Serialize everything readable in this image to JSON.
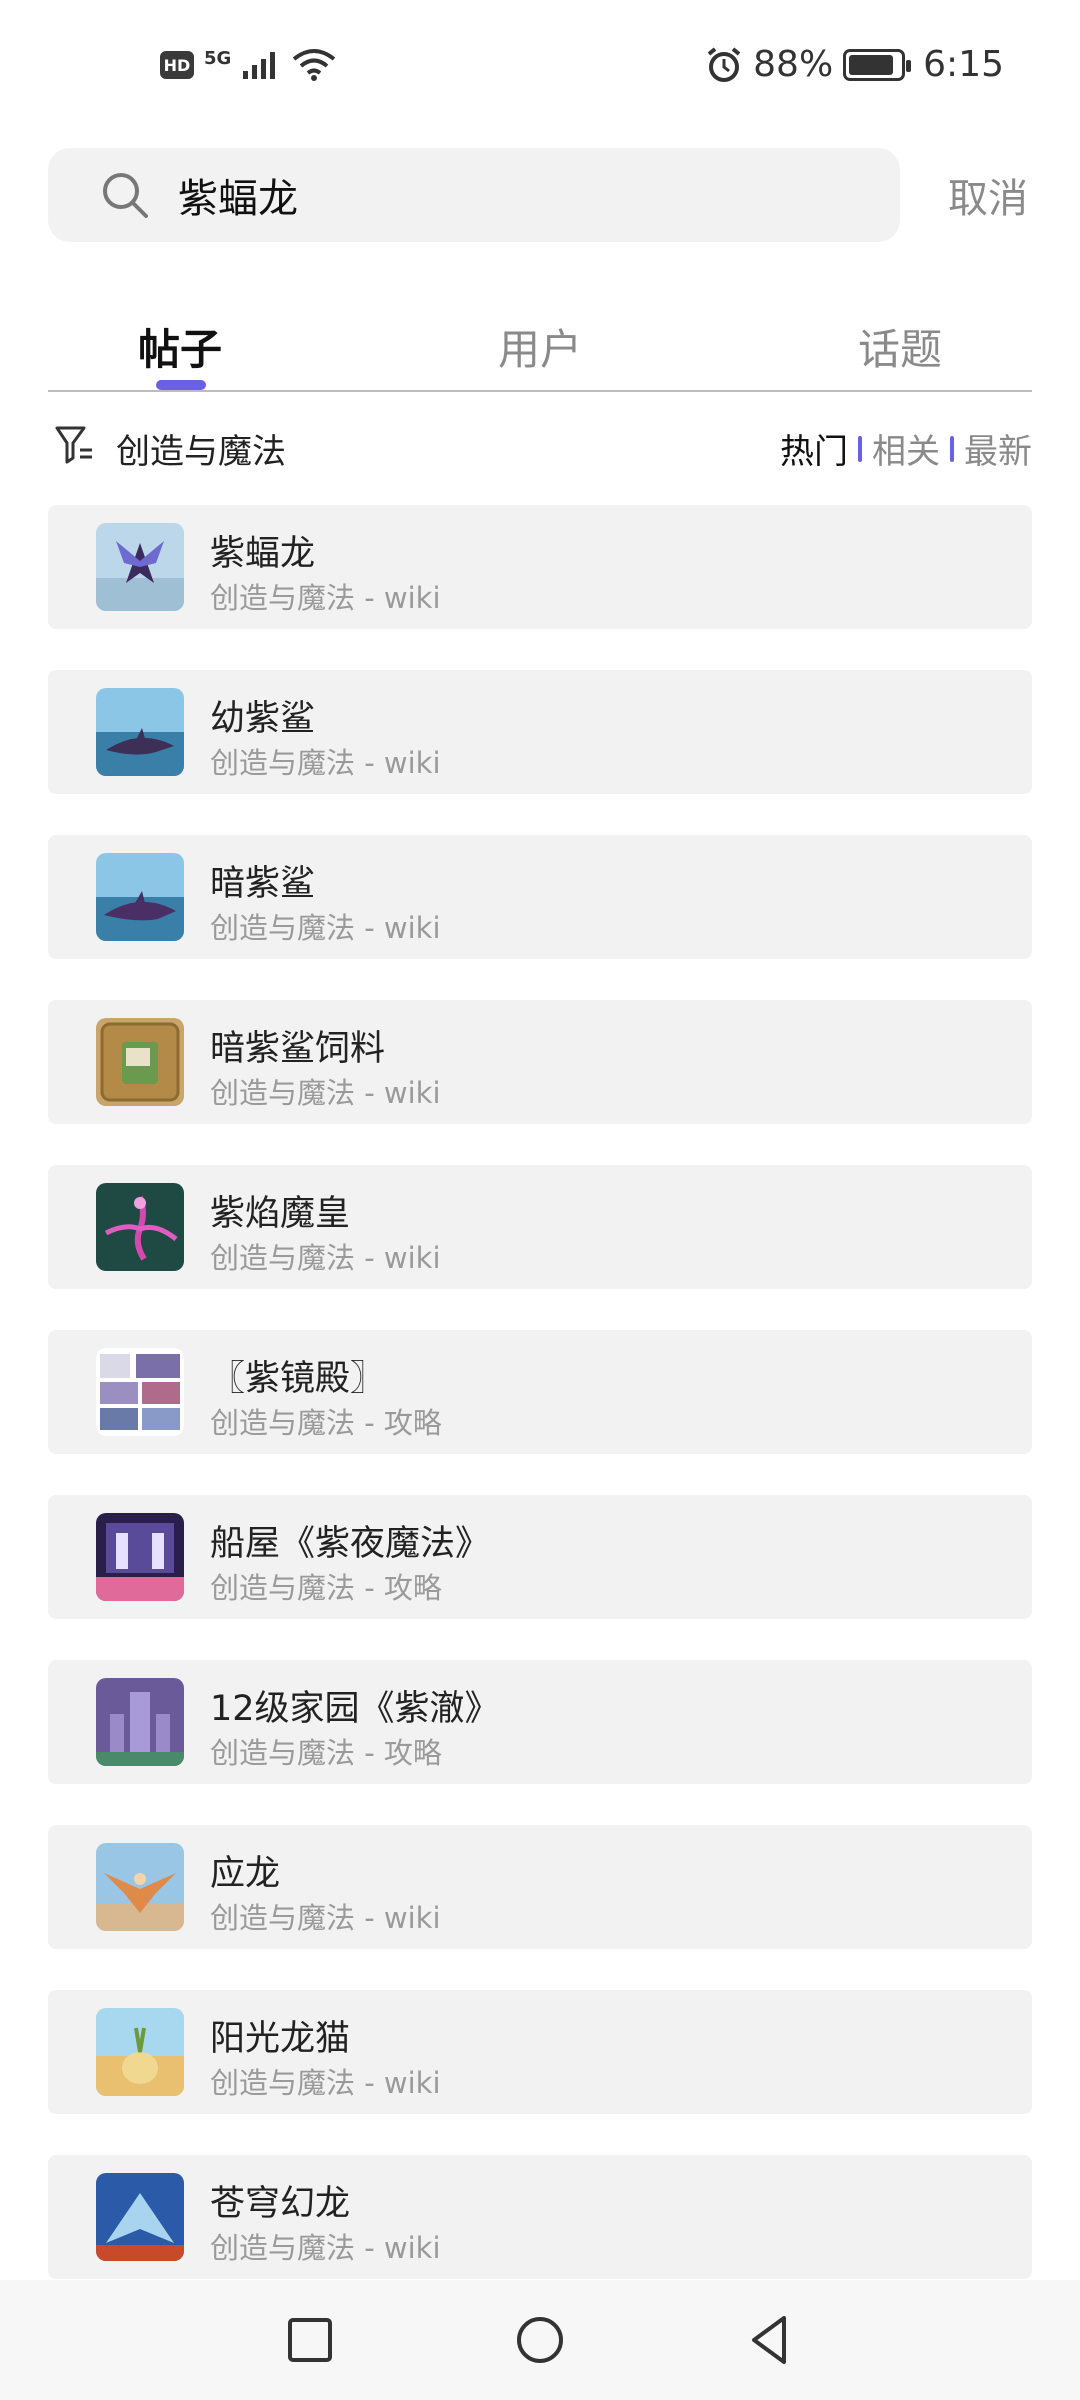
{
  "status_bar": {
    "hd": "HD",
    "network": "5G",
    "battery_percent": "88%",
    "time": "6:15",
    "battery_level": 0.88
  },
  "search": {
    "query": "紫蝠龙",
    "cancel_label": "取消"
  },
  "tabs": [
    {
      "label": "帖子",
      "active": true
    },
    {
      "label": "用户",
      "active": false
    },
    {
      "label": "话题",
      "active": false
    }
  ],
  "filter": {
    "label": "创造与魔法",
    "sort_options": [
      {
        "label": "热门",
        "active": true
      },
      {
        "label": "相关",
        "active": false
      },
      {
        "label": "最新",
        "active": false
      }
    ]
  },
  "results": [
    {
      "title": "紫蝠龙",
      "subtitle": "创造与魔法 - wiki",
      "thumb": "purple-bat-dragon"
    },
    {
      "title": "幼紫鲨",
      "subtitle": "创造与魔法 - wiki",
      "thumb": "young-purple-shark"
    },
    {
      "title": "暗紫鲨",
      "subtitle": "创造与魔法 - wiki",
      "thumb": "dark-purple-shark"
    },
    {
      "title": "暗紫鲨饲料",
      "subtitle": "创造与魔法 - wiki",
      "thumb": "shark-feed"
    },
    {
      "title": "紫焰魔皇",
      "subtitle": "创造与魔法 - wiki",
      "thumb": "purple-flame-demon"
    },
    {
      "title": "〖紫镜殿〗",
      "subtitle": "创造与魔法 - 攻略",
      "thumb": "screenshot-collage"
    },
    {
      "title": "船屋《紫夜魔法》",
      "subtitle": "创造与魔法 - 攻略",
      "thumb": "boathouse"
    },
    {
      "title": "12级家园《紫澈》",
      "subtitle": "创造与魔法 - 攻略",
      "thumb": "purple-castle"
    },
    {
      "title": "应龙",
      "subtitle": "创造与魔法 - wiki",
      "thumb": "winged-dragon"
    },
    {
      "title": "阳光龙猫",
      "subtitle": "创造与魔法 - wiki",
      "thumb": "sunny-chinchilla"
    },
    {
      "title": "苍穹幻龙",
      "subtitle": "创造与魔法 - wiki",
      "thumb": "sky-dragon"
    }
  ],
  "colors": {
    "accent": "#6a60e6",
    "card_bg": "#f2f2f2",
    "muted_text": "#9a9a9a"
  },
  "nav": {
    "icons": [
      "recent-apps-icon",
      "home-icon",
      "back-icon"
    ]
  }
}
